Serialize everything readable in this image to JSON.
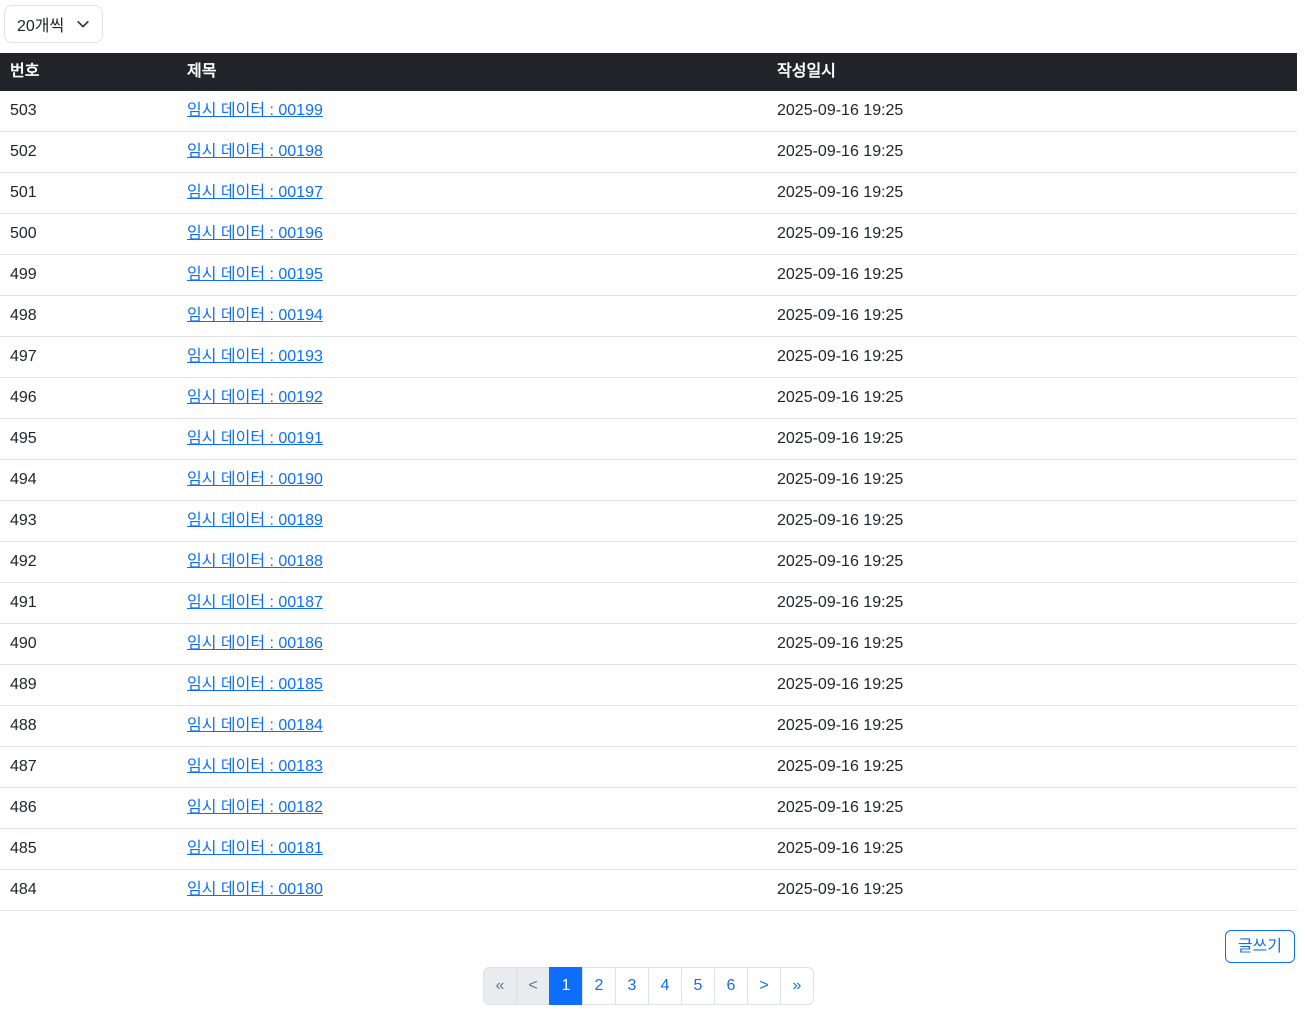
{
  "page_size_select": {
    "value": "20개씩"
  },
  "table": {
    "headers": [
      "번호",
      "제목",
      "작성일시"
    ],
    "rows": [
      {
        "no": "503",
        "title": "임시 데이터 : 00199",
        "date": "2025-09-16 19:25"
      },
      {
        "no": "502",
        "title": "임시 데이터 : 00198",
        "date": "2025-09-16 19:25"
      },
      {
        "no": "501",
        "title": "임시 데이터 : 00197",
        "date": "2025-09-16 19:25"
      },
      {
        "no": "500",
        "title": "임시 데이터 : 00196",
        "date": "2025-09-16 19:25"
      },
      {
        "no": "499",
        "title": "임시 데이터 : 00195",
        "date": "2025-09-16 19:25"
      },
      {
        "no": "498",
        "title": "임시 데이터 : 00194",
        "date": "2025-09-16 19:25"
      },
      {
        "no": "497",
        "title": "임시 데이터 : 00193",
        "date": "2025-09-16 19:25"
      },
      {
        "no": "496",
        "title": "임시 데이터 : 00192",
        "date": "2025-09-16 19:25"
      },
      {
        "no": "495",
        "title": "임시 데이터 : 00191",
        "date": "2025-09-16 19:25"
      },
      {
        "no": "494",
        "title": "임시 데이터 : 00190",
        "date": "2025-09-16 19:25"
      },
      {
        "no": "493",
        "title": "임시 데이터 : 00189",
        "date": "2025-09-16 19:25"
      },
      {
        "no": "492",
        "title": "임시 데이터 : 00188",
        "date": "2025-09-16 19:25"
      },
      {
        "no": "491",
        "title": "임시 데이터 : 00187",
        "date": "2025-09-16 19:25"
      },
      {
        "no": "490",
        "title": "임시 데이터 : 00186",
        "date": "2025-09-16 19:25"
      },
      {
        "no": "489",
        "title": "임시 데이터 : 00185",
        "date": "2025-09-16 19:25"
      },
      {
        "no": "488",
        "title": "임시 데이터 : 00184",
        "date": "2025-09-16 19:25"
      },
      {
        "no": "487",
        "title": "임시 데이터 : 00183",
        "date": "2025-09-16 19:25"
      },
      {
        "no": "486",
        "title": "임시 데이터 : 00182",
        "date": "2025-09-16 19:25"
      },
      {
        "no": "485",
        "title": "임시 데이터 : 00181",
        "date": "2025-09-16 19:25"
      },
      {
        "no": "484",
        "title": "임시 데이터 : 00180",
        "date": "2025-09-16 19:25"
      }
    ]
  },
  "pagination": {
    "items": [
      {
        "label": "«",
        "state": "disabled"
      },
      {
        "label": "<",
        "state": "disabled"
      },
      {
        "label": "1",
        "state": "active"
      },
      {
        "label": "2",
        "state": "normal"
      },
      {
        "label": "3",
        "state": "normal"
      },
      {
        "label": "4",
        "state": "normal"
      },
      {
        "label": "5",
        "state": "normal"
      },
      {
        "label": "6",
        "state": "normal"
      },
      {
        "label": ">",
        "state": "normal"
      },
      {
        "label": "»",
        "state": "normal"
      }
    ]
  },
  "write_button": {
    "label": "글쓰기"
  },
  "colors": {
    "accent": "#0d6efd",
    "header_bg": "#212529",
    "border": "#dee2e6",
    "link": "#0d6efd",
    "disabled_bg": "#e9ecef",
    "disabled_text": "#6c757d"
  }
}
